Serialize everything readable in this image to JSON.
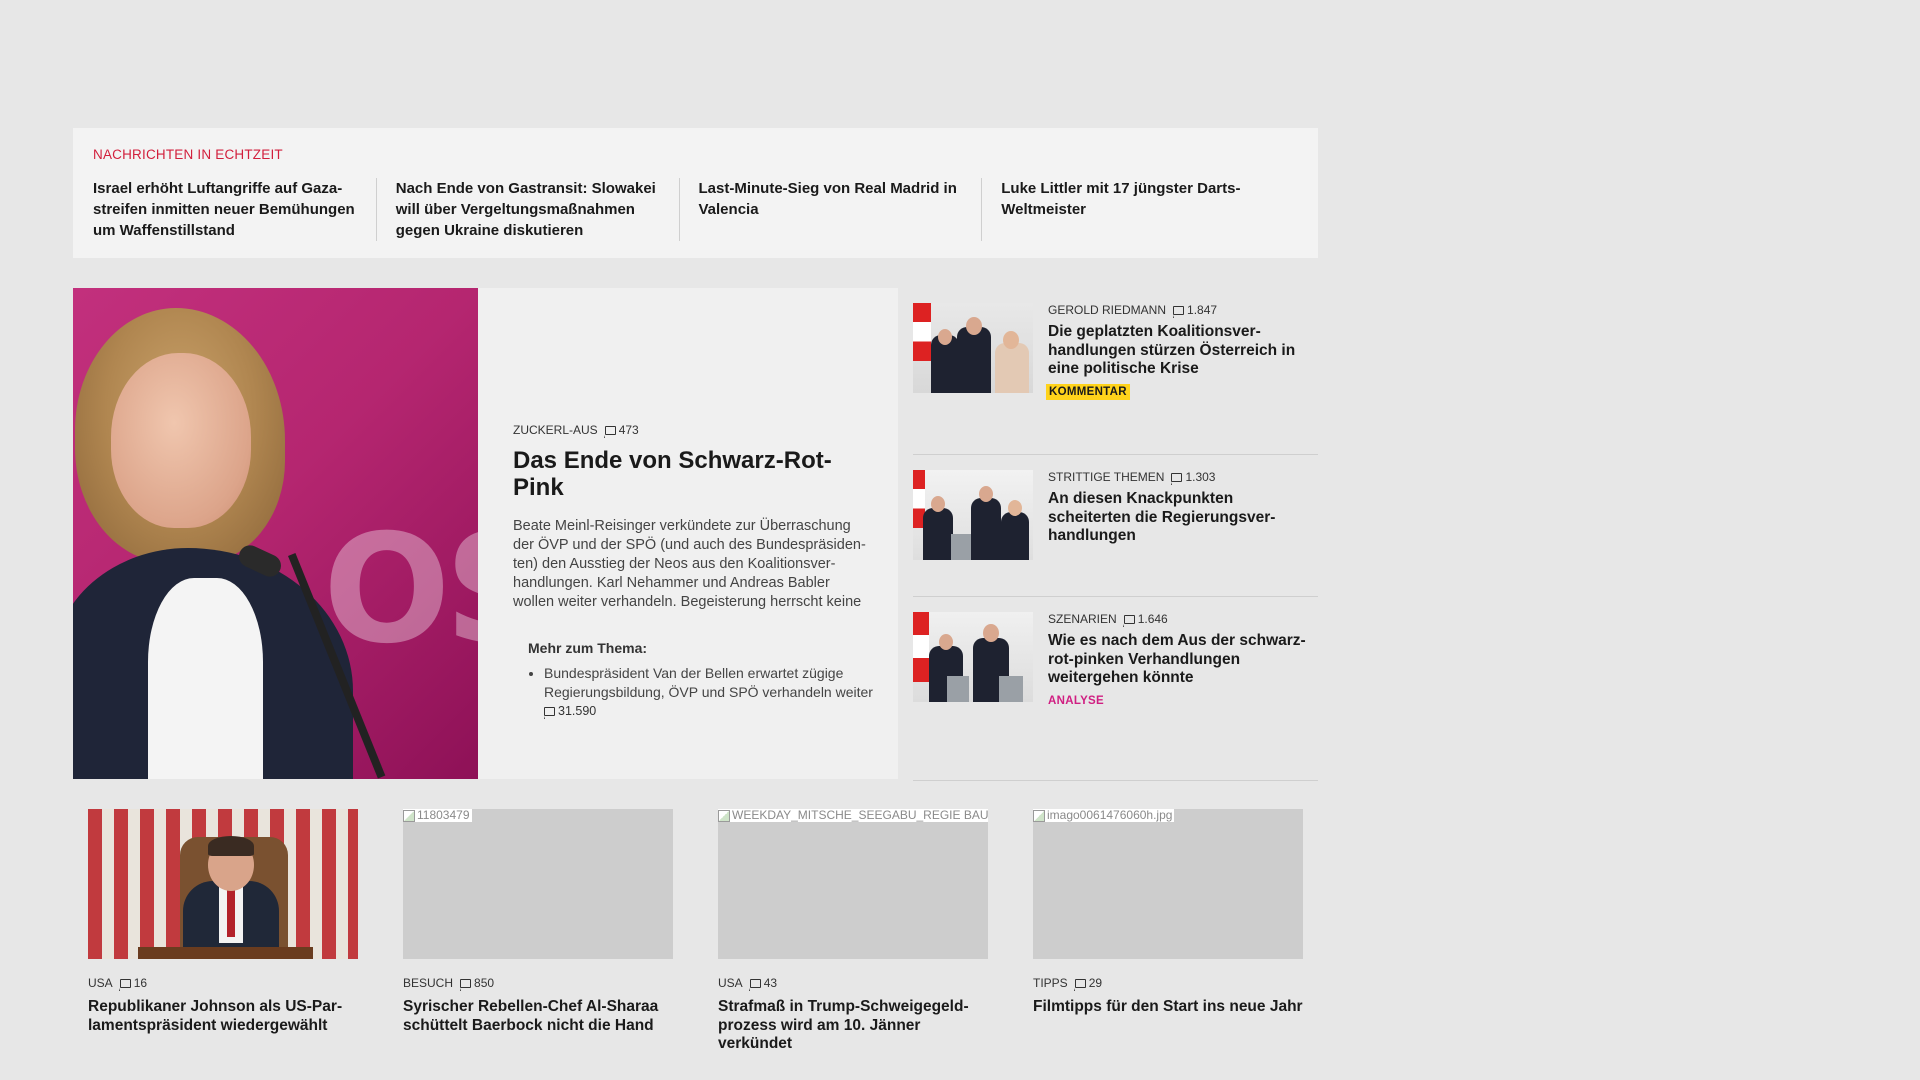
{
  "ticker": {
    "label": "NACHRICHTEN IN ECHTZEIT",
    "items": [
      {
        "text": "Israel erhöht Luftangriffe auf Gaza­streifen inmitten neuer Bemühungen um Waffenstillstand"
      },
      {
        "text": "Nach Ende von Gastransit: Slowakei will über Vergeltungsmaßnahmen ge­gen Ukraine diskutieren"
      },
      {
        "text": "Last-Minute-Sieg von Real Madrid in Valencia"
      },
      {
        "text": "Luke Littler mit 17 jüngster Darts-Weltmeister"
      }
    ]
  },
  "hero": {
    "kicker": "ZUCKERL-AUS",
    "comments": "473",
    "title": "Das Ende von Schwarz-Rot-Pink",
    "teaser": "Beate Meinl-Reisinger verkündete zur Überraschung der ÖVP und der SPÖ (und auch des Bundespräsiden­ten) den Ausstieg der Neos aus den Koalitionsver­handlungen. Karl Nehammer und Andreas Babler wollen weiter verhandeln. Begeisterung herrscht keine",
    "image_text": "OS",
    "related": {
      "heading": "Mehr zum Thema:",
      "items": [
        {
          "text": "Bundespräsident Van der Bellen erwartet zügige Regierungsbildung, ÖVP und SPÖ verhandeln weiter",
          "comments": "31.590"
        }
      ]
    }
  },
  "side": [
    {
      "kicker": "GEROLD RIEDMANN",
      "comments": "1.847",
      "title": "Die geplatzten Koalitionsver­handlungen stürzen Österreich in eine politische Krise",
      "badge": "KOMMENTAR"
    },
    {
      "kicker": "STRITTIGE THEMEN",
      "comments": "1.303",
      "title": "An diesen Knackpunkten scheiterten die Regierungsver­handlungen",
      "badge": ""
    },
    {
      "kicker": "SZENARIEN",
      "comments": "1.646",
      "title": "Wie es nach dem Aus der schwarz-rot-pinken Verhandlungen weitergehen könnte",
      "badge": "ANALYSE"
    }
  ],
  "cards": [
    {
      "kicker": "USA",
      "comments": "16",
      "title": "Republikaner Johnson als US-Par­lamentspräsident wiedergewählt",
      "alt": ""
    },
    {
      "kicker": "BESUCH",
      "comments": "850",
      "title": "Syrischer Rebellen-Chef Al-Sharaa schüttelt Baerbock nicht die Hand",
      "alt": "11803479"
    },
    {
      "kicker": "USA",
      "comments": "43",
      "title": "Strafmaß in Trump-Schweigegeld­prozess wird am 10. Jänner verkündet",
      "alt": "WEEKDAY_MITSCHE_SEEGABU_REGIE BAU"
    },
    {
      "kicker": "TIPPS",
      "comments": "29",
      "title": "Filmtipps für den Start ins neue Jahr",
      "alt": "imago0061476060h.jpg"
    }
  ],
  "colors": {
    "accent_red": "#d21f3c",
    "kommentar_badge": "#ffd31b",
    "analyse_text": "#d01f82",
    "page_bg": "#e7e7e7"
  }
}
